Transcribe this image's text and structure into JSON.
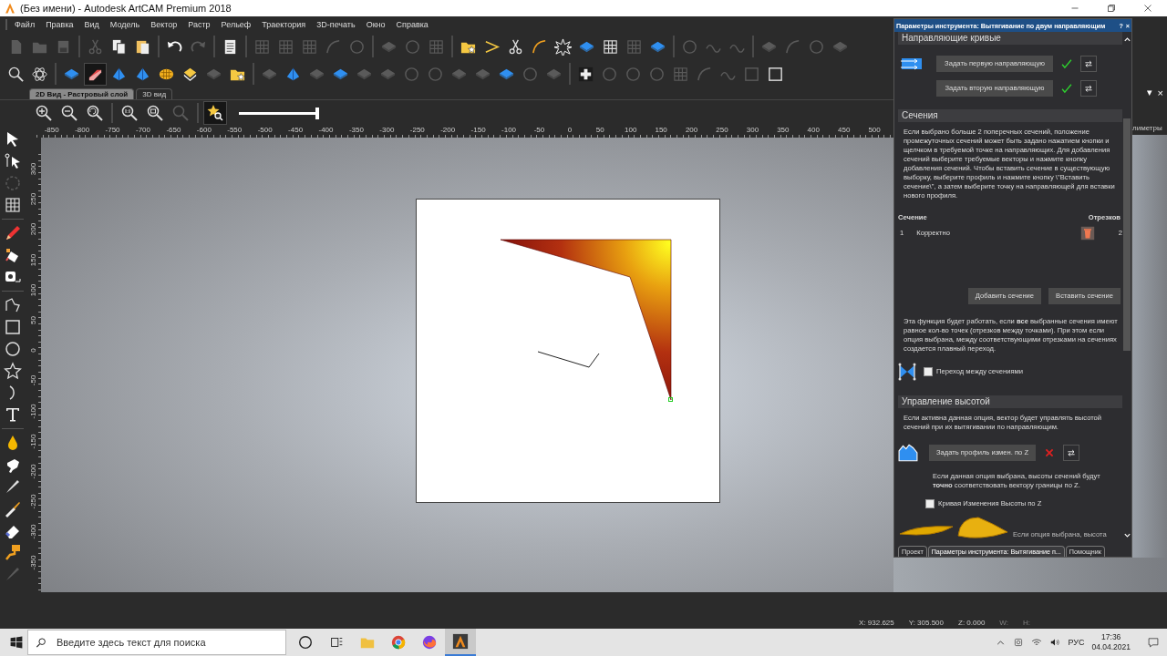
{
  "window": {
    "title": "(Без имени) - Autodesk ArtCAM Premium 2018"
  },
  "menu": [
    "Файл",
    "Правка",
    "Вид",
    "Модель",
    "Вектор",
    "Растр",
    "Рельеф",
    "Траектория",
    "3D-печать",
    "Окно",
    "Справка"
  ],
  "toolbar_1": [
    [
      {
        "kind": "page",
        "disabled": true
      },
      {
        "kind": "folder",
        "disabled": true
      },
      {
        "kind": "disk",
        "disabled": true
      }
    ],
    [
      {
        "kind": "scissors",
        "disabled": true
      },
      {
        "kind": "pages",
        "disabled": false
      },
      {
        "kind": "clipboard",
        "disabled": false
      }
    ],
    [
      {
        "kind": "undo",
        "disabled": false
      },
      {
        "kind": "redo",
        "disabled": true
      }
    ],
    [
      {
        "kind": "notepad",
        "disabled": false
      }
    ],
    [
      {
        "kind": "grid",
        "disabled": true
      },
      {
        "kind": "grid",
        "disabled": true
      },
      {
        "kind": "grid",
        "disabled": true
      },
      {
        "kind": "curve",
        "disabled": true
      },
      {
        "kind": "ring",
        "disabled": true
      }
    ],
    [
      {
        "kind": "block",
        "disabled": true
      },
      {
        "kind": "ring",
        "disabled": true
      },
      {
        "kind": "grid",
        "disabled": true
      }
    ],
    [
      {
        "kind": "folderstar",
        "disabled": false
      },
      {
        "kind": "chevron",
        "disabled": false
      },
      {
        "kind": "scissors",
        "disabled": false
      },
      {
        "kind": "curve",
        "disabled": false
      },
      {
        "kind": "burst",
        "disabled": false
      },
      {
        "kind": "block",
        "disabled": false
      },
      {
        "kind": "grid",
        "disabled": false
      },
      {
        "kind": "grid",
        "disabled": true
      },
      {
        "kind": "block",
        "disabled": false
      }
    ],
    [
      {
        "kind": "ring",
        "disabled": true
      },
      {
        "kind": "wave",
        "disabled": true
      },
      {
        "kind": "wave",
        "disabled": true
      }
    ],
    [
      {
        "kind": "block",
        "disabled": true
      },
      {
        "kind": "curve",
        "disabled": true
      },
      {
        "kind": "ring",
        "disabled": true
      },
      {
        "kind": "block",
        "disabled": true
      }
    ]
  ],
  "toolbar_2": [
    [
      {
        "kind": "magnifier",
        "disabled": false,
        "selected": false
      },
      {
        "kind": "atom",
        "disabled": false,
        "selected": false
      }
    ],
    [
      {
        "kind": "block",
        "disabled": false,
        "selected": false
      },
      {
        "kind": "ribbon",
        "disabled": false,
        "selected": true
      },
      {
        "kind": "peak",
        "disabled": false,
        "selected": false
      },
      {
        "kind": "peak",
        "disabled": false,
        "selected": false
      },
      {
        "kind": "waffle",
        "disabled": false,
        "selected": false
      },
      {
        "kind": "gem",
        "disabled": false,
        "selected": false
      },
      {
        "kind": "block",
        "disabled": true,
        "selected": false
      },
      {
        "kind": "folderstar",
        "disabled": false,
        "selected": false
      }
    ],
    [
      {
        "kind": "block",
        "disabled": true,
        "selected": false
      },
      {
        "kind": "peak",
        "disabled": false,
        "selected": false
      },
      {
        "kind": "block",
        "disabled": true,
        "selected": false
      },
      {
        "kind": "block",
        "disabled": false,
        "selected": false
      },
      {
        "kind": "block",
        "disabled": true,
        "selected": false
      },
      {
        "kind": "block",
        "disabled": true,
        "selected": false
      },
      {
        "kind": "ring",
        "disabled": true,
        "selected": false
      },
      {
        "kind": "ring",
        "disabled": true,
        "selected": false
      },
      {
        "kind": "block",
        "disabled": true,
        "selected": false
      },
      {
        "kind": "block",
        "disabled": true,
        "selected": false
      },
      {
        "kind": "block",
        "disabled": false,
        "selected": false
      },
      {
        "kind": "ring",
        "disabled": true,
        "selected": false
      },
      {
        "kind": "block",
        "disabled": true,
        "selected": false
      }
    ],
    [
      {
        "kind": "plus",
        "disabled": false,
        "selected": false
      },
      {
        "kind": "ring",
        "disabled": true,
        "selected": false
      },
      {
        "kind": "ring",
        "disabled": true,
        "selected": false
      },
      {
        "kind": "ring",
        "disabled": true,
        "selected": false
      },
      {
        "kind": "grid",
        "disabled": true,
        "selected": false
      },
      {
        "kind": "curve",
        "disabled": true,
        "selected": false
      },
      {
        "kind": "wave",
        "disabled": true,
        "selected": false
      },
      {
        "kind": "rect",
        "disabled": true,
        "selected": false
      },
      {
        "kind": "rect",
        "disabled": false,
        "selected": false
      }
    ]
  ],
  "view_tabs": [
    {
      "label": "2D Вид - Растровый слой",
      "selected": true
    },
    {
      "label": "3D вид",
      "selected": false
    }
  ],
  "zoom_bar": {
    "tools": [
      [
        {
          "kind": "zoomin",
          "disabled": false,
          "selected": false
        },
        {
          "kind": "zoomout",
          "disabled": false,
          "selected": false
        },
        {
          "kind": "zoomback",
          "disabled": false,
          "selected": false
        }
      ],
      [
        {
          "kind": "zoomone",
          "disabled": false,
          "selected": false
        },
        {
          "kind": "zoomfit",
          "disabled": false,
          "selected": false
        },
        {
          "kind": "magnifier",
          "disabled": true,
          "selected": false
        }
      ],
      [
        {
          "kind": "starzoom",
          "disabled": false,
          "selected": true
        }
      ]
    ],
    "slider": {
      "level": 1
    }
  },
  "ruler_h": [
    "-850",
    "-800",
    "-750",
    "-700",
    "-650",
    "-600",
    "-550",
    "-500",
    "-450",
    "-400",
    "-350",
    "-300",
    "-250",
    "-200",
    "-150",
    "-100",
    "-50",
    "0",
    "50",
    "100",
    "150",
    "200",
    "250",
    "300",
    "350",
    "400",
    "450",
    "500"
  ],
  "ruler_v": [
    "300",
    "250",
    "200",
    "150",
    "100",
    "50",
    "0",
    "-50",
    "-100",
    "-150",
    "-200",
    "-250",
    "-300",
    "-350"
  ],
  "ruler_unit": "лиметры",
  "side_controls": [
    "▾",
    "×"
  ],
  "left_tools": [
    [
      {
        "kind": "pointer",
        "disabled": false
      },
      {
        "kind": "node",
        "disabled": false
      },
      {
        "kind": "rotate",
        "disabled": true
      },
      {
        "kind": "grid",
        "disabled": false
      }
    ],
    [
      {
        "kind": "pencil",
        "disabled": false
      },
      {
        "kind": "bucket",
        "disabled": false
      },
      {
        "kind": "tape",
        "disabled": false
      }
    ],
    [
      {
        "kind": "polyline",
        "disabled": false
      },
      {
        "kind": "rect",
        "disabled": false
      },
      {
        "kind": "ring",
        "disabled": false
      },
      {
        "kind": "star",
        "disabled": false
      },
      {
        "kind": "arc",
        "disabled": false
      },
      {
        "kind": "text",
        "disabled": false
      }
    ],
    [
      {
        "kind": "drop",
        "disabled": false
      },
      {
        "kind": "hand",
        "disabled": false
      },
      {
        "kind": "brush",
        "disabled": false
      },
      {
        "kind": "knife",
        "disabled": false
      },
      {
        "kind": "eraser",
        "disabled": false
      },
      {
        "kind": "roller",
        "disabled": false
      },
      {
        "kind": "brush",
        "disabled": true
      }
    ]
  ],
  "panel": {
    "title": "Параметры инструмента: Вытягивание по двум направляющим",
    "help": "?",
    "close": "×",
    "guides": {
      "heading": "Направляющие кривые",
      "buttons": [
        {
          "label": "Задать первую направляющую",
          "set": true
        },
        {
          "label": "Задать вторую направляющую",
          "set": true
        }
      ]
    },
    "sections": {
      "heading": "Сечения",
      "description": "Если выбрано больше 2 поперечных сечений, положение промежуточных сечений может быть задано нажатием кнопки и щелчком в требуемой точке на направляющих. Для добавления сечений выберите требуемые векторы и нажмите кнопку добавления сечений. Чтобы вставить сечение в существующую выборку, выберите профиль и нажмите кнопку \\\"Вставить сечение\\\", а затем выберите точку на направляющей для вставки нового профиля.",
      "columns": [
        "Сечение",
        "Отрезков"
      ],
      "rows": [
        {
          "index": "1",
          "status": "Корректно",
          "segments": "2"
        }
      ],
      "buttons": [
        "Добавить сечение",
        "Вставить сечение"
      ],
      "note": "Эта функция будет работать, если **все** выбранные сечения имеют равное кол-во точек (отрезков между точками). При этом если опция выбрана, между соответствующими отрезками на сечениях создается плавный переход.",
      "blend": {
        "label": "Переход между сечениями",
        "checked": false
      }
    },
    "height": {
      "heading": "Управление высотой",
      "description": "Если активна данная опция, вектор будет управлять высотой сечений при их вытягивании по направляющим.",
      "button": {
        "label": "Задать профиль измен. по Z",
        "set": false
      },
      "note": "Если данная опция выбрана, высоты сечений будут **точно** соответствовать вектору границы по Z.",
      "curve": {
        "label": "Кривая Изменения Высоты по Z",
        "checked": false
      },
      "cut_text": "Если опция выбрана, высота"
    },
    "tabs": [
      {
        "label": "Проект",
        "selected": false
      },
      {
        "label": "Параметры инструмента: Вытягивание п...",
        "selected": true
      },
      {
        "label": "Помощник",
        "selected": false
      }
    ]
  },
  "status": [
    {
      "text": "X: 932.625",
      "disabled": false
    },
    {
      "text": "Y: 305.500",
      "disabled": false
    },
    {
      "text": "Z: 0.000",
      "disabled": false
    },
    {
      "text": "W:",
      "disabled": true
    },
    {
      "text": "H:",
      "disabled": true
    }
  ],
  "taskbar": {
    "search_placeholder": "Введите здесь текст для поиска",
    "apps": [
      {
        "kind": "ring",
        "selected": false
      },
      {
        "kind": "taskview",
        "selected": false
      },
      {
        "kind": "folder",
        "selected": false
      },
      {
        "kind": "chrome",
        "selected": false
      },
      {
        "kind": "firefox",
        "selected": false
      },
      {
        "kind": "artcam",
        "selected": true
      }
    ],
    "language": "РУС",
    "time": "17:36",
    "date": "04.04.2021"
  }
}
